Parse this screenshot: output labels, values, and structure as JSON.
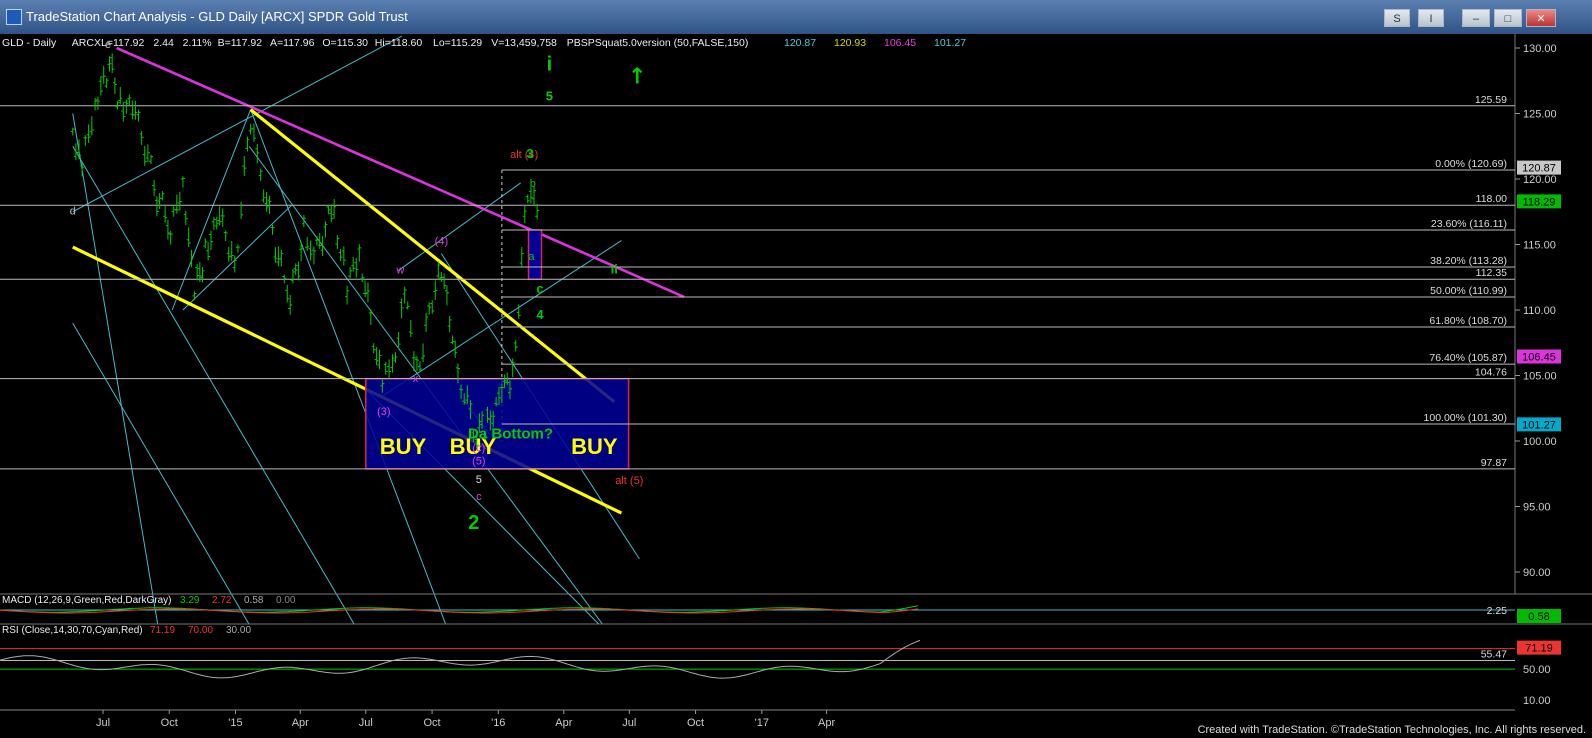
{
  "window": {
    "title": "TradeStation Chart Analysis - GLD Daily [ARCX] SPDR Gold Trust",
    "buttons": [
      "S",
      "I"
    ]
  },
  "header": {
    "symbol": "GLD - Daily",
    "exchange": "ARCX",
    "last": "L=117.92",
    "change": "2.44",
    "pct": "2.11%",
    "bid": "B=117.92",
    "ask": "A=117.96",
    "open": "O=115.30",
    "high": "Hi=118.60",
    "low": "Lo=115.29",
    "volume": "V=13,459,758",
    "study": "PBSPSquat5.0version (50,FALSE,150)",
    "study_values": [
      {
        "text": "120.87",
        "color": "#4ec9d8"
      },
      {
        "text": "120.93",
        "color": "#d8d800"
      },
      {
        "text": "106.45",
        "color": "#e040e0"
      },
      {
        "text": "101.27",
        "color": "#4ec9d8"
      }
    ]
  },
  "chart_data": {
    "type": "line",
    "title": "GLD Daily [ARCX] SPDR Gold Trust",
    "x_tick_labels": [
      "Jul",
      "Oct",
      "'15",
      "Apr",
      "Jul",
      "Oct",
      "'16",
      "Apr",
      "Jul",
      "Oct",
      "'17",
      "Apr"
    ],
    "y_tick_labels": [
      "130.00",
      "125.00",
      "120.00",
      "115.00",
      "110.00",
      "105.00",
      "100.00",
      "95.00",
      "90.00"
    ],
    "ylim": [
      88,
      131.5
    ],
    "price_series": {
      "name": "GLD",
      "color": "#00cc00",
      "points": [
        [
          "2014-05-20",
          124.0
        ],
        [
          "2014-06-02",
          121.0
        ],
        [
          "2014-06-20",
          125.5
        ],
        [
          "2014-07-10",
          128.5
        ],
        [
          "2014-07-25",
          126.0
        ],
        [
          "2014-08-15",
          125.5
        ],
        [
          "2014-09-10",
          119.5
        ],
        [
          "2014-10-03",
          116.0
        ],
        [
          "2014-10-20",
          119.5
        ],
        [
          "2014-11-05",
          111.0
        ],
        [
          "2014-11-20",
          114.5
        ],
        [
          "2014-12-10",
          117.5
        ],
        [
          "2014-12-31",
          113.5
        ],
        [
          "2015-01-22",
          124.5
        ],
        [
          "2015-02-05",
          120.0
        ],
        [
          "2015-03-18",
          110.5
        ],
        [
          "2015-04-06",
          116.0
        ],
        [
          "2015-04-20",
          114.5
        ],
        [
          "2015-05-18",
          117.5
        ],
        [
          "2015-06-05",
          112.0
        ],
        [
          "2015-06-22",
          114.0
        ],
        [
          "2015-07-24",
          104.5
        ],
        [
          "2015-08-07",
          105.0
        ],
        [
          "2015-08-24",
          111.5
        ],
        [
          "2015-09-10",
          105.5
        ],
        [
          "2015-10-14",
          113.5
        ],
        [
          "2015-11-06",
          104.8
        ],
        [
          "2015-12-02",
          100.5
        ],
        [
          "2015-12-17",
          101.0
        ],
        [
          "2016-01-06",
          104.0
        ],
        [
          "2016-01-21",
          105.0
        ],
        [
          "2016-02-11",
          119.5
        ],
        [
          "2016-02-24",
          117.5
        ]
      ]
    },
    "horizontal_levels": [
      {
        "label": "125.59",
        "value": 125.59
      },
      {
        "label": "0.00% (120.69)",
        "value": 120.69
      },
      {
        "label": "118.00",
        "value": 118.0
      },
      {
        "label": "23.60% (116.11)",
        "value": 116.11
      },
      {
        "label": "38.20% (113.28)",
        "value": 113.28
      },
      {
        "label": "112.35",
        "value": 112.35
      },
      {
        "label": "50.00% (110.99)",
        "value": 110.99
      },
      {
        "label": "61.80% (108.70)",
        "value": 108.7
      },
      {
        "label": "76.40% (105.87)",
        "value": 105.87
      },
      {
        "label": "104.76",
        "value": 104.76
      },
      {
        "label": "100.00% (101.30)",
        "value": 101.3
      },
      {
        "label": "97.87",
        "value": 97.87
      }
    ],
    "right_badges": [
      {
        "label": "120.87",
        "value": 120.87,
        "bg": "#c8c8c8",
        "fg": "#000"
      },
      {
        "label": "118.29",
        "value": 118.29,
        "bg": "#00bb00",
        "fg": "#000"
      },
      {
        "label": "106.45",
        "value": 106.45,
        "bg": "#dd33dd",
        "fg": "#000"
      },
      {
        "label": "101.27",
        "value": 101.27,
        "bg": "#00aacc",
        "fg": "#000"
      }
    ],
    "buy_zone": {
      "x_from": "2015-07-01",
      "x_to": "2016-06-30",
      "y_low": 97.87,
      "y_high": 104.76,
      "labels": [
        "BUY",
        "BUY",
        "BUY"
      ]
    },
    "small_box": {
      "x_from": "2016-02-12",
      "x_to": "2016-03-01",
      "y_low": 112.35,
      "y_high": 116.11
    },
    "wave_labels": [
      {
        "text": "e",
        "x": "2014-07-08",
        "y": 130.0,
        "color": "#c0c0c0"
      },
      {
        "text": "d",
        "x": "2014-05-20",
        "y": 117.3,
        "color": "#c0c0c0"
      },
      {
        "text": "w",
        "x": "2015-08-18",
        "y": 112.8,
        "color": "#e040e0"
      },
      {
        "text": "x",
        "x": "2015-09-08",
        "y": 104.5,
        "color": "#e040e0"
      },
      {
        "text": "(4)",
        "x": "2015-10-14",
        "y": 115.0,
        "color": "#e040e0"
      },
      {
        "text": "(3)",
        "x": "2015-07-26",
        "y": 102.0,
        "color": "#e040e0"
      },
      {
        "text": "(c)",
        "x": "2015-12-05",
        "y": 99.2,
        "color": "#e040e0"
      },
      {
        "text": "(5)",
        "x": "2015-12-05",
        "y": 98.2,
        "color": "#e040e0"
      },
      {
        "text": "5",
        "x": "2015-12-05",
        "y": 96.8,
        "color": "#e0e0e0"
      },
      {
        "text": "c",
        "x": "2015-12-05",
        "y": 95.5,
        "color": "#e040e0"
      },
      {
        "text": "2",
        "x": "2015-11-28",
        "y": 93.3,
        "color": "#00cc00"
      },
      {
        "text": "Da Bottom?",
        "x": "2016-01-18",
        "y": 100.2,
        "color": "#00cc00"
      },
      {
        "text": "alt (4)",
        "x": "2016-02-06",
        "y": 121.6,
        "color": "#ee3333"
      },
      {
        "text": "3",
        "x": "2016-02-14",
        "y": 121.6,
        "color": "#00cc00"
      },
      {
        "text": "b",
        "x": "2016-02-18",
        "y": 119.4,
        "color": "#00cc00"
      },
      {
        "text": "a",
        "x": "2016-02-16",
        "y": 113.8,
        "color": "#00cc00"
      },
      {
        "text": "c",
        "x": "2016-02-28",
        "y": 111.3,
        "color": "#00cc00"
      },
      {
        "text": "4",
        "x": "2016-02-28",
        "y": 109.3,
        "color": "#00cc00"
      },
      {
        "text": "i",
        "x": "2016-03-12",
        "y": 128.3,
        "color": "#00cc00"
      },
      {
        "text": "5",
        "x": "2016-03-12",
        "y": 126.0,
        "color": "#00cc00"
      },
      {
        "text": "ii",
        "x": "2016-06-10",
        "y": 112.8,
        "color": "#00cc00"
      },
      {
        "text": "alt (5)",
        "x": "2016-07-01",
        "y": 96.7,
        "color": "#ee3333"
      }
    ],
    "macd": {
      "label": "MACD (12,26,9,Green,Red,DarkGray)",
      "values": [
        "3.29",
        "2.72",
        "0.58",
        "0.00"
      ],
      "right_labels": [
        "2.25",
        "0.58"
      ]
    },
    "rsi": {
      "label": "RSI (Close,14,30,70,Cyan,Red)",
      "values": [
        "71.19",
        "70.00",
        "30.00"
      ],
      "tick_labels": [
        "71.19",
        "55.47",
        "50.00",
        "10.00"
      ]
    }
  },
  "footer": "Created with TradeStation. ©TradeStation Technologies, Inc. All rights reserved."
}
